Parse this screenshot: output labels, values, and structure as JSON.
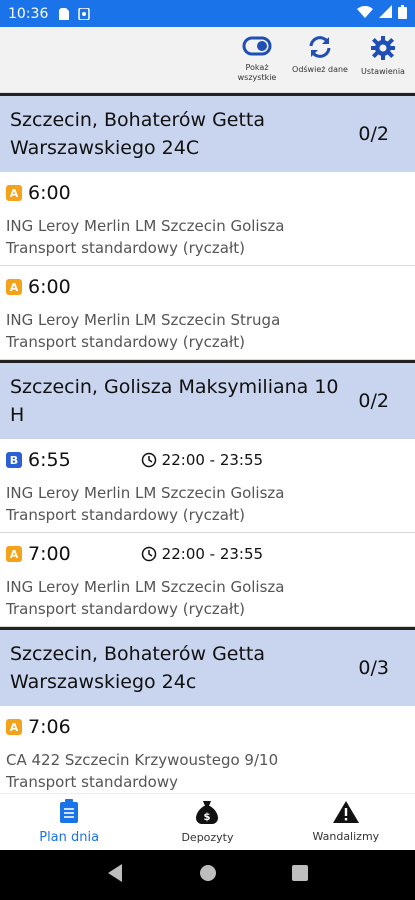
{
  "status": {
    "time": "10:36"
  },
  "toolbar": {
    "show_all_label": "Pokaż wszystkie",
    "refresh_label": "Odśwież dane",
    "settings_label": "Ustawienia"
  },
  "groups": [
    {
      "address": "Szczecin, Bohaterów Getta Warszawskiego 24C",
      "count": "0/2",
      "stops": [
        {
          "badge": "A",
          "time": "6:00",
          "window": "",
          "client": "ING Leroy Merlin LM Szczecin Golisza",
          "transport": "Transport standardowy (ryczałt)"
        },
        {
          "badge": "A",
          "time": "6:00",
          "window": "",
          "client": "ING Leroy Merlin LM Szczecin Struga",
          "transport": "Transport standardowy (ryczałt)"
        }
      ]
    },
    {
      "address": "Szczecin, Golisza Maksymiliana 10 H",
      "count": "0/2",
      "stops": [
        {
          "badge": "B",
          "time": "6:55",
          "window": "22:00 - 23:55",
          "client": "ING Leroy Merlin LM Szczecin Golisza",
          "transport": "Transport standardowy (ryczałt)"
        },
        {
          "badge": "A",
          "time": "7:00",
          "window": "22:00 - 23:55",
          "client": "ING Leroy Merlin LM Szczecin Golisza",
          "transport": "Transport standardowy (ryczałt)"
        }
      ]
    },
    {
      "address": "Szczecin, Bohaterów Getta Warszawskiego 24c",
      "count": "0/3",
      "stops": [
        {
          "badge": "A",
          "time": "7:06",
          "window": "",
          "client": "CA 422 Szczecin Krzywoustego 9/10",
          "transport": "Transport standardowy"
        }
      ]
    }
  ],
  "bottom_nav": {
    "plan_label": "Plan dnia",
    "deposits_label": "Depozyty",
    "vandalism_label": "Wandalizmy"
  },
  "colors": {
    "accent": "#1a73e8",
    "header_bg": "#c9d4ee",
    "badge_a": "#f3a21a",
    "badge_b": "#2a5fd6"
  }
}
